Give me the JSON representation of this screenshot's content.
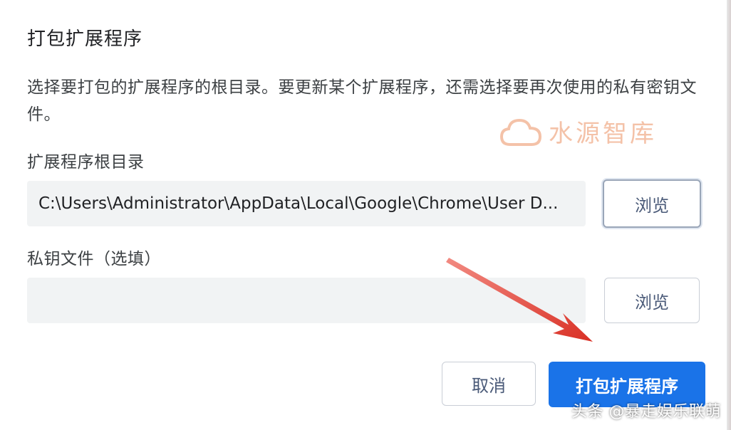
{
  "dialog": {
    "title": "打包扩展程序",
    "description": "选择要打包的扩展程序的根目录。要更新某个扩展程序，还需选择要再次使用的私有密钥文件。"
  },
  "root_dir": {
    "label": "扩展程序根目录",
    "value": "C:\\Users\\Administrator\\AppData\\Local\\Google\\Chrome\\User D...",
    "browse_label": "浏览"
  },
  "private_key": {
    "label": "私钥文件（选填）",
    "value": "",
    "browse_label": "浏览"
  },
  "actions": {
    "cancel_label": "取消",
    "pack_label": "打包扩展程序"
  },
  "watermark": {
    "text": "水源智库",
    "icon": "cloud-icon"
  },
  "footer": {
    "text": "头条 @暴走娱乐联萌"
  },
  "annotation": {
    "icon": "red-arrow-icon",
    "color": "#e53935"
  },
  "colors": {
    "accent": "#1a73e8",
    "input_bg": "#f1f3f4",
    "watermark": "#f3b89a"
  }
}
